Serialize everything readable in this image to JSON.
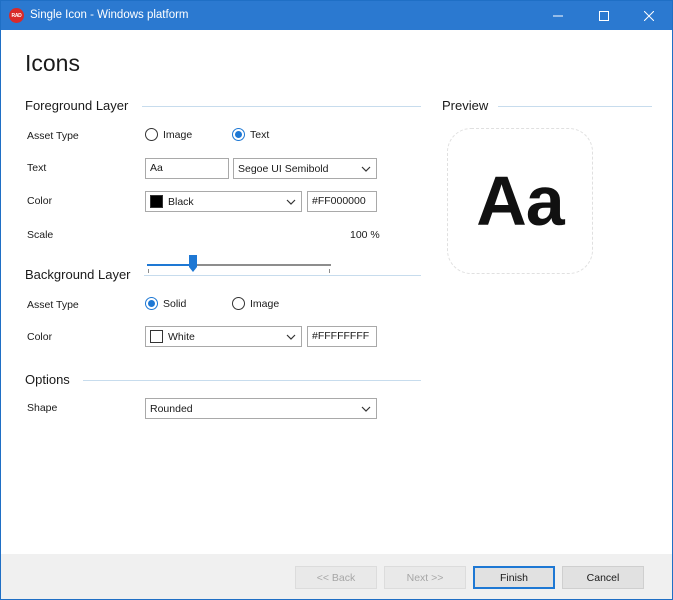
{
  "window": {
    "icon_text": "RAD",
    "title": "Single Icon - Windows platform"
  },
  "page": {
    "title": "Icons"
  },
  "foreground": {
    "section_title": "Foreground Layer",
    "asset_type_label": "Asset Type",
    "asset_type_options": [
      "Image",
      "Text"
    ],
    "asset_type_selected": "Text",
    "text_label": "Text",
    "text_value": "Aa",
    "font_value": "Segoe UI Semibold",
    "color_label": "Color",
    "color_name": "Black",
    "color_hex": "#FF000000",
    "swatch_color": "#000000",
    "scale_label": "Scale",
    "scale_value": "100 %",
    "scale_fraction": 0.25
  },
  "background": {
    "section_title": "Background Layer",
    "asset_type_label": "Asset Type",
    "asset_type_options": [
      "Solid",
      "Image"
    ],
    "asset_type_selected": "Solid",
    "color_label": "Color",
    "color_name": "White",
    "color_hex": "#FFFFFFFF",
    "swatch_color": "#FFFFFF"
  },
  "options": {
    "section_title": "Options",
    "shape_label": "Shape",
    "shape_value": "Rounded"
  },
  "preview": {
    "section_title": "Preview",
    "text": "Aa"
  },
  "footer": {
    "back_label": "<< Back",
    "next_label": "Next >>",
    "finish_label": "Finish",
    "cancel_label": "Cancel"
  },
  "colors": {
    "titlebar": "#2b79d0",
    "accent": "#1e78d4"
  }
}
